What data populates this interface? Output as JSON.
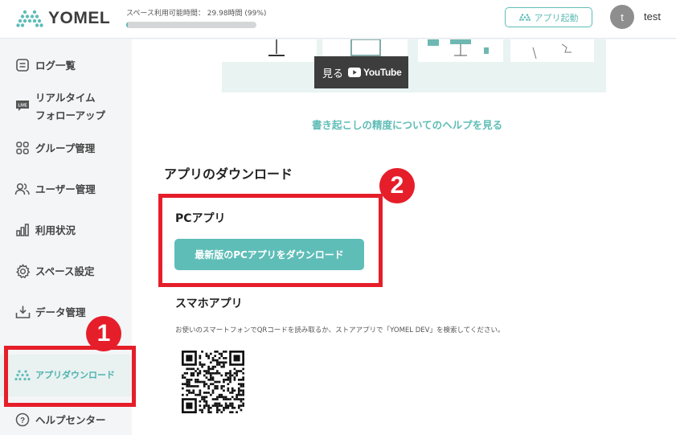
{
  "header": {
    "logo_text": "YOMEL",
    "usage_label": "スペース利用可能時間： 29.98時間 (99%)",
    "usage_fraction": 0.01,
    "launch_button": "アプリ起動",
    "avatar_initial": "t",
    "username": "test"
  },
  "sidebar": {
    "items": [
      {
        "label": "ログ一覧",
        "icon": "list-icon"
      },
      {
        "label": "リアルタイム",
        "label2": "フォローアップ",
        "icon": "live-icon"
      },
      {
        "label": "グループ管理",
        "icon": "group-icon"
      },
      {
        "label": "ユーザー管理",
        "icon": "users-icon"
      },
      {
        "label": "利用状況",
        "icon": "bar-chart-icon"
      },
      {
        "label": "スペース設定",
        "icon": "gear-icon"
      },
      {
        "label": "データ管理",
        "icon": "download-tray-icon"
      },
      {
        "label": "アプリダウンロード",
        "icon": "yomel-logo-icon",
        "active": true
      },
      {
        "label": "ヘルプセンター",
        "icon": "help-icon"
      }
    ]
  },
  "main": {
    "video": {
      "watch_label": "見る",
      "youtube_label": "YouTube"
    },
    "help_link": "書き起こしの精度についてのヘルプを見る",
    "section_title": "アプリのダウンロード",
    "pc_title": "PCアプリ",
    "pc_download_button": "最新版のPCアプリをダウンロード",
    "sp_title": "スマホアプリ",
    "sp_description": "お使いのスマートフォンでQRコードを読み取るか、ストアアプリで「YOMEL DEV」を検索してください。"
  },
  "annotations": {
    "badge_1": "1",
    "badge_2": "2",
    "color": "#e51e2a"
  },
  "colors": {
    "accent": "#5fbdb7",
    "highlight": "#e51e2a"
  }
}
